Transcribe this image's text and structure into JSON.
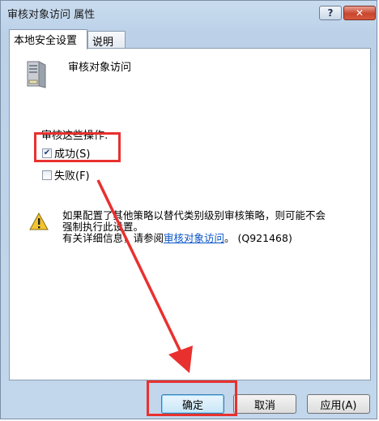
{
  "window": {
    "title": "审核对象访问 属性",
    "help_label": "?",
    "close_label": "✕"
  },
  "tabs": [
    {
      "label": "本地安全设置",
      "selected": true
    },
    {
      "label": "说明",
      "selected": false
    }
  ],
  "policy": {
    "icon": "server-icon",
    "heading": "审核对象访问"
  },
  "audit": {
    "group_label": "审核这些操作:",
    "success_label": "成功(S)",
    "success_checked": true,
    "failure_label": "失败(F)",
    "failure_checked": false
  },
  "warning": {
    "icon": "warning-icon",
    "line1": "如果配置了其他策略以替代类别级别审核策略，则可能不会",
    "line2": "强制执行此设置。",
    "line3_prefix": "有关详细信息，请参阅",
    "link_text": "审核对象访问",
    "line3_suffix": "。 (Q921468)"
  },
  "buttons": {
    "ok_label": "确定",
    "cancel_label": "取消",
    "apply_label": "应用(A)"
  },
  "annotation": {
    "color": "#e8312f"
  }
}
